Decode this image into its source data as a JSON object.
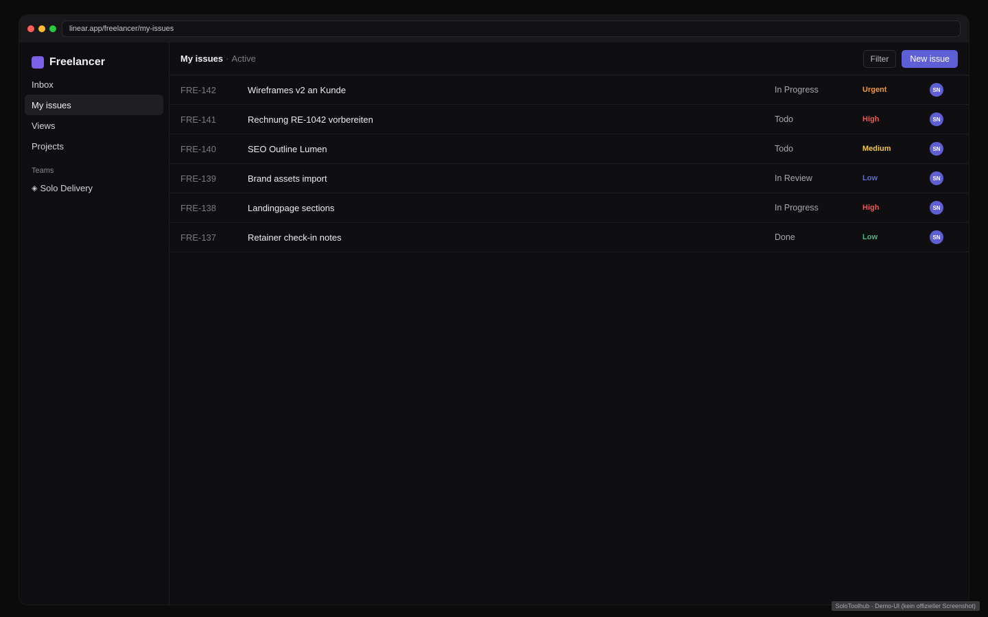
{
  "browser": {
    "url": "linear.app/freelancer/my-issues"
  },
  "sidebar": {
    "workspace_name": "Freelancer",
    "items": [
      {
        "label": "Inbox"
      },
      {
        "label": "My issues"
      },
      {
        "label": "Views"
      },
      {
        "label": "Projects"
      }
    ],
    "teams_label": "Teams",
    "team": {
      "glyph": "◈",
      "label": "Solo Delivery"
    }
  },
  "header": {
    "title": "My issues",
    "separator": "·",
    "filter_state": "Active",
    "filter_button": "Filter",
    "new_issue_button": "New issue"
  },
  "issues": [
    {
      "id": "FRE-142",
      "title": "Wireframes v2 an Kunde",
      "status": "In Progress",
      "priority": "Urgent",
      "priority_color": "#f2994a",
      "assignee": "SN"
    },
    {
      "id": "FRE-141",
      "title": "Rechnung RE-1042 vorbereiten",
      "status": "Todo",
      "priority": "High",
      "priority_color": "#eb5757",
      "assignee": "SN"
    },
    {
      "id": "FRE-140",
      "title": "SEO Outline Lumen",
      "status": "Todo",
      "priority": "Medium",
      "priority_color": "#f2c94c",
      "assignee": "SN"
    },
    {
      "id": "FRE-139",
      "title": "Brand assets import",
      "status": "In Review",
      "priority": "Low",
      "priority_color": "#5e6ad2",
      "assignee": "SN"
    },
    {
      "id": "FRE-138",
      "title": "Landingpage sections",
      "status": "In Progress",
      "priority": "High",
      "priority_color": "#eb5757",
      "assignee": "SN"
    },
    {
      "id": "FRE-137",
      "title": "Retainer check-in notes",
      "status": "Done",
      "priority": "Low",
      "priority_color": "#4cb782",
      "assignee": "SN"
    }
  ],
  "watermark": "SoloToolhub · Demo-UI (kein offizieller Screenshot)"
}
